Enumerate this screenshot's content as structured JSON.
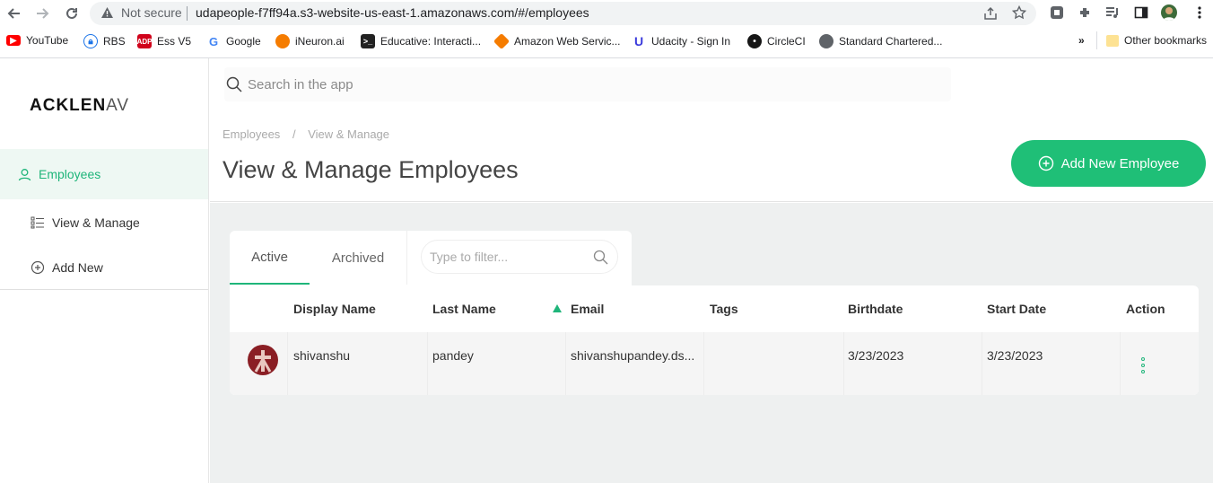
{
  "browser": {
    "not_secure": "Not secure",
    "url": "udapeople-f7ff94a.s3-website-us-east-1.amazonaws.com/#/employees"
  },
  "bookmarks": [
    {
      "label": "YouTube",
      "icon": "youtube-icon",
      "color": "#ff0000"
    },
    {
      "label": "RBS",
      "icon": "lock-icon",
      "color": "#1a73e8"
    },
    {
      "label": "Ess V5",
      "icon": "adp-icon",
      "color": "#d0021b"
    },
    {
      "label": "Google",
      "icon": "google-icon",
      "color": "#4285f4"
    },
    {
      "label": "iNeuron.ai",
      "icon": "ineuron-icon",
      "color": "#f57c00"
    },
    {
      "label": "Educative: Interacti...",
      "icon": "educative-icon",
      "color": "#222222"
    },
    {
      "label": "Amazon Web Servic...",
      "icon": "aws-icon",
      "color": "#f57c00"
    },
    {
      "label": "Udacity - Sign In",
      "icon": "udacity-icon",
      "color": "#3c3cdc"
    },
    {
      "label": "CircleCI",
      "icon": "circleci-icon",
      "color": "#161616"
    },
    {
      "label": "Standard Chartered...",
      "icon": "globe-icon",
      "color": "#5f6368"
    }
  ],
  "other_bookmarks": "Other bookmarks",
  "overflow": "»",
  "app": {
    "logo_bold": "ACKLEN",
    "logo_light": "AV",
    "sidebar": [
      {
        "label": "Employees",
        "icon": "user-icon"
      },
      {
        "label": "View & Manage",
        "icon": "list-icon"
      },
      {
        "label": "Add New",
        "icon": "plus-circle-icon"
      }
    ],
    "search_placeholder": "Search in the app",
    "breadcrumb": [
      "Employees",
      "View & Manage"
    ],
    "breadcrumb_sep": "/",
    "page_title": "View & Manage Employees",
    "add_button": "Add New Employee",
    "tabs": [
      "Active",
      "Archived"
    ],
    "filter_placeholder": "Type to filter...",
    "columns": [
      "Display Name",
      "Last Name",
      "Email",
      "Tags",
      "Birthdate",
      "Start Date",
      "Action"
    ],
    "rows": [
      {
        "display_name": "shivanshu",
        "last_name": "pandey",
        "email": "shivanshupandey.ds...",
        "tags": "",
        "birthdate": "3/23/2023",
        "start_date": "3/23/2023"
      }
    ]
  },
  "colors": {
    "accent": "#1fbf77",
    "sidebar_active_bg": "#eef8f3",
    "content_bg": "#eef0f0"
  }
}
